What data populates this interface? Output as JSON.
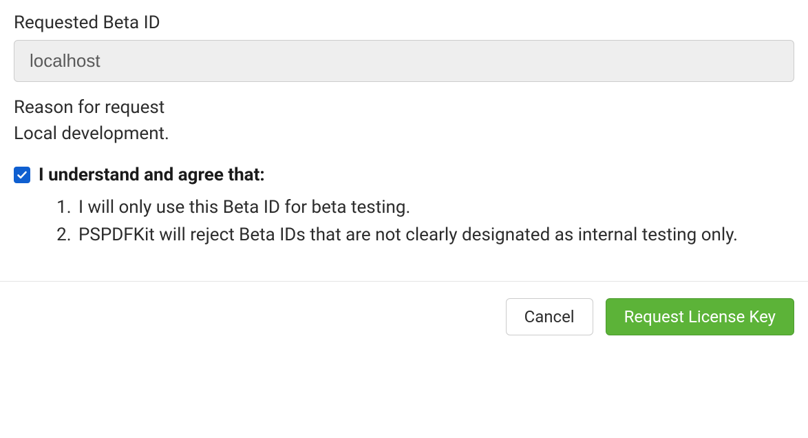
{
  "form": {
    "beta_id_label": "Requested Beta ID",
    "beta_id_value": "localhost",
    "reason_label": "Reason for request",
    "reason_value": "Local development."
  },
  "agreement": {
    "checked": true,
    "heading": "I understand and agree that:",
    "items": [
      "I will only use this Beta ID for beta testing.",
      "PSPDFKit will reject Beta IDs that are not clearly designated as internal testing only."
    ]
  },
  "buttons": {
    "cancel": "Cancel",
    "submit": "Request License Key"
  },
  "colors": {
    "checkbox_bg": "#0f5fd0",
    "primary_btn_bg": "#5cb338",
    "primary_btn_border": "#4a9a2d",
    "input_bg": "#eeeeee"
  }
}
